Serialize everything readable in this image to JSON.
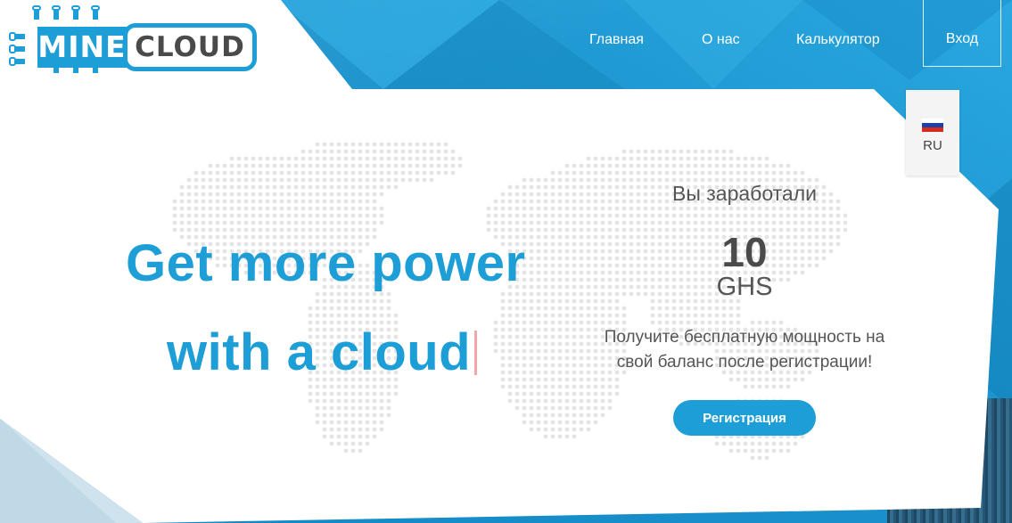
{
  "brand": {
    "logo_left": "MINE",
    "logo_right": "CLOUD"
  },
  "nav": {
    "items": [
      {
        "label": "Главная"
      },
      {
        "label": "О нас"
      },
      {
        "label": "Калькулятор"
      }
    ],
    "login_label": "Вход"
  },
  "language": {
    "code": "RU",
    "flag_icon": "russia-flag-icon"
  },
  "hero": {
    "line1": "Get more power",
    "line2": "with a cloud"
  },
  "earnings": {
    "title": "Вы заработали",
    "value": "10",
    "unit": "GHS",
    "description_line1": "Получите бесплатную мощность на",
    "description_line2": "свой баланс после регистрации!",
    "register_label": "Регистрация"
  },
  "colors": {
    "accent": "#1e9ed6",
    "text_dark": "#4a4a4a",
    "cursor": "#f4a5a5"
  }
}
